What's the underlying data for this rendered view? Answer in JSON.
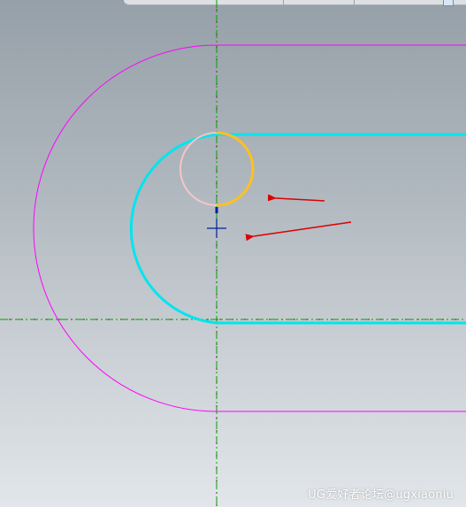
{
  "app": {
    "watermark_text": "UG爱好者论坛@ugxiaoniu"
  },
  "canvas": {
    "background_top": "#96a0a8",
    "background_bottom": "#e2e6ea"
  },
  "colors": {
    "outer_profile": "#ff00ff",
    "inner_profile": "#00e5ee",
    "centerline": "#00a000",
    "circle_preview_light": "#f4c6c6",
    "circle_preview_highlight": "#ffc020",
    "annotation_arrow": "#dd0000",
    "cursor_cross": "#001f9c"
  },
  "icons": {
    "cursor": "crosshair-cursor-icon",
    "arrow": "red-arrow-icon"
  }
}
